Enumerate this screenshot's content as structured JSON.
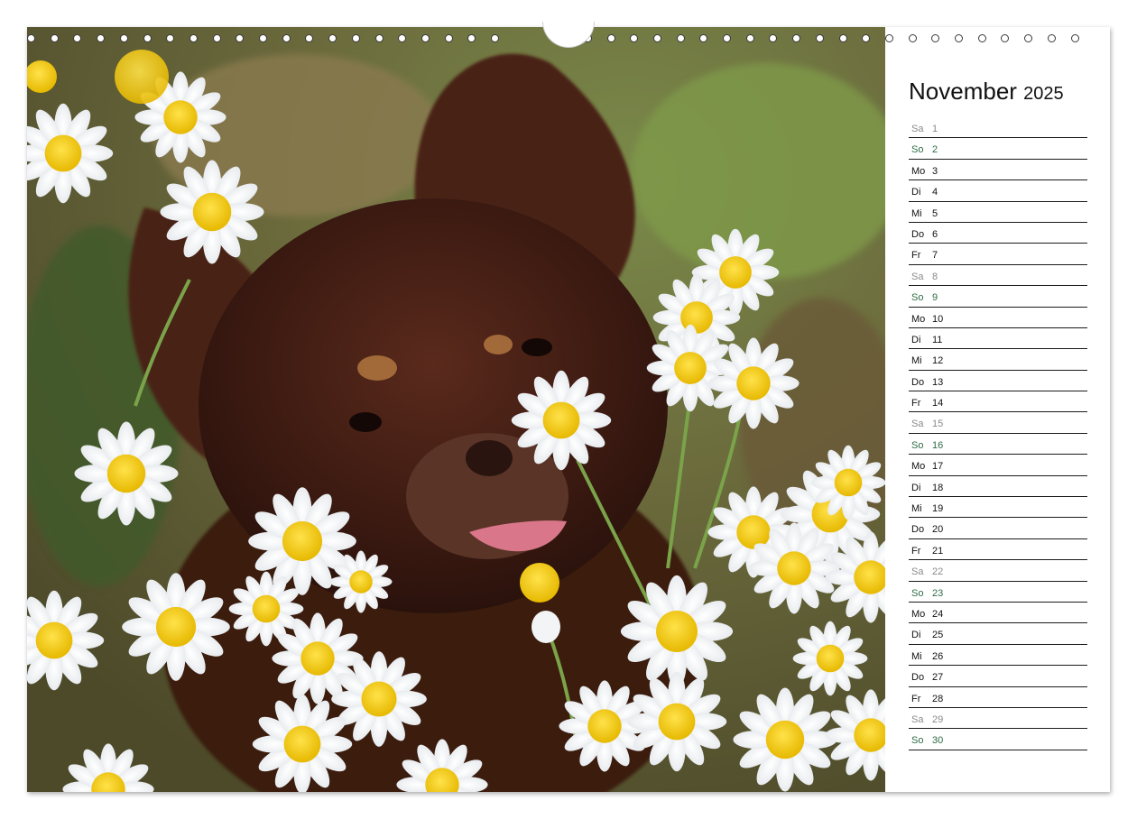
{
  "calendar": {
    "month": "November",
    "year": "2025",
    "days": [
      {
        "name": "Sa",
        "num": "1",
        "type": "sat"
      },
      {
        "name": "So",
        "num": "2",
        "type": "sun"
      },
      {
        "name": "Mo",
        "num": "3",
        "type": "week"
      },
      {
        "name": "Di",
        "num": "4",
        "type": "week"
      },
      {
        "name": "Mi",
        "num": "5",
        "type": "week"
      },
      {
        "name": "Do",
        "num": "6",
        "type": "week"
      },
      {
        "name": "Fr",
        "num": "7",
        "type": "week"
      },
      {
        "name": "Sa",
        "num": "8",
        "type": "sat"
      },
      {
        "name": "So",
        "num": "9",
        "type": "sun"
      },
      {
        "name": "Mo",
        "num": "10",
        "type": "week"
      },
      {
        "name": "Di",
        "num": "11",
        "type": "week"
      },
      {
        "name": "Mi",
        "num": "12",
        "type": "week"
      },
      {
        "name": "Do",
        "num": "13",
        "type": "week"
      },
      {
        "name": "Fr",
        "num": "14",
        "type": "week"
      },
      {
        "name": "Sa",
        "num": "15",
        "type": "sat"
      },
      {
        "name": "So",
        "num": "16",
        "type": "sun"
      },
      {
        "name": "Mo",
        "num": "17",
        "type": "week"
      },
      {
        "name": "Di",
        "num": "18",
        "type": "week"
      },
      {
        "name": "Mi",
        "num": "19",
        "type": "week"
      },
      {
        "name": "Do",
        "num": "20",
        "type": "week"
      },
      {
        "name": "Fr",
        "num": "21",
        "type": "week"
      },
      {
        "name": "Sa",
        "num": "22",
        "type": "sat"
      },
      {
        "name": "So",
        "num": "23",
        "type": "sun"
      },
      {
        "name": "Mo",
        "num": "24",
        "type": "week"
      },
      {
        "name": "Di",
        "num": "25",
        "type": "week"
      },
      {
        "name": "Mi",
        "num": "26",
        "type": "week"
      },
      {
        "name": "Do",
        "num": "27",
        "type": "week"
      },
      {
        "name": "Fr",
        "num": "28",
        "type": "week"
      },
      {
        "name": "Sa",
        "num": "29",
        "type": "sat"
      },
      {
        "name": "So",
        "num": "30",
        "type": "sun"
      }
    ]
  },
  "colors": {
    "weekday": "#111111",
    "saturday": "#8a8a8a",
    "sunday": "#2e6b45"
  },
  "icons": {
    "binding": "spiral-binding-holes",
    "hanger": "hanger-cutout"
  }
}
